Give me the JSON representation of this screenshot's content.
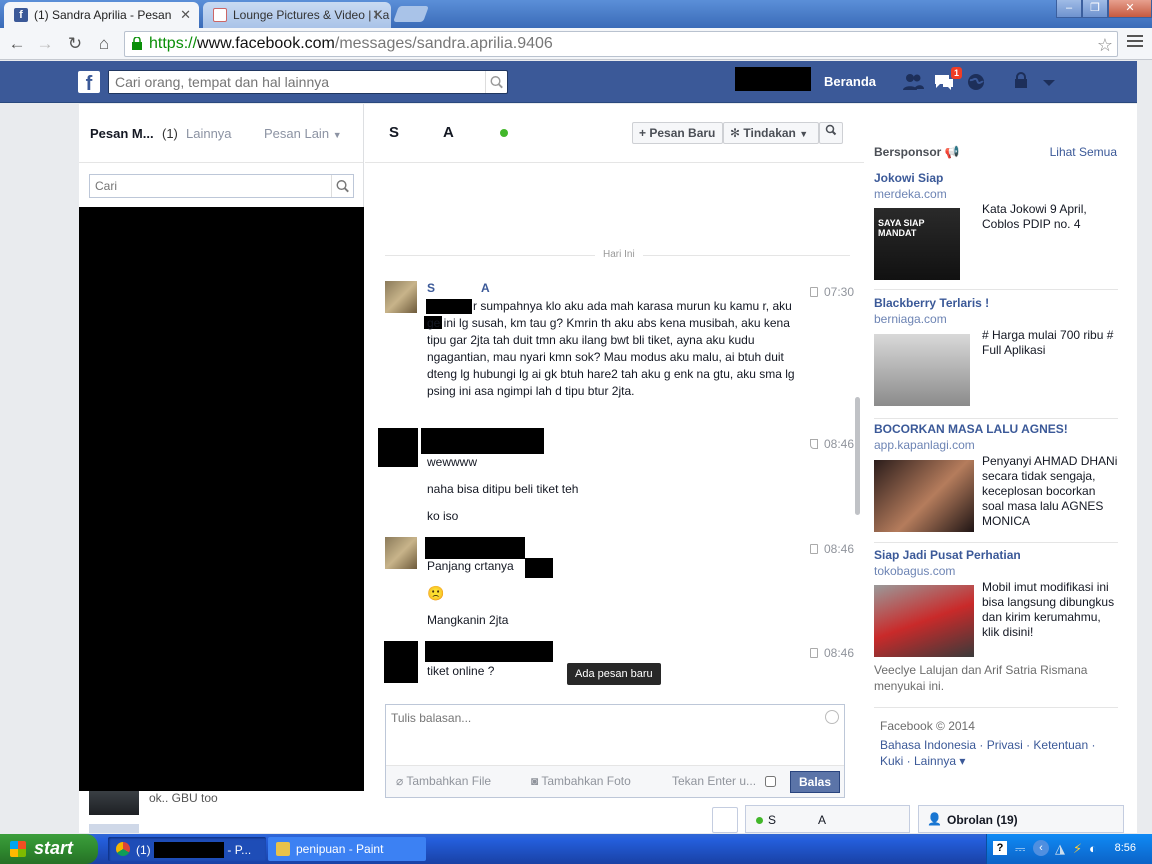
{
  "browser": {
    "tabs": [
      {
        "label": "(1) Sandra Aprilia - Pesan",
        "active": true
      },
      {
        "label": "Lounge Pictures & Video | Ka",
        "active": false
      }
    ],
    "url": {
      "scheme": "https://",
      "host": "www.facebook.com",
      "path": "/messages/sandra.aprilia.9406"
    }
  },
  "fb_header": {
    "search_placeholder": "Cari orang, tempat dan hal lainnya",
    "home_label": "Beranda",
    "notification_count": "1"
  },
  "left": {
    "title": "Pesan M...",
    "count": "(1)",
    "other_label": "Lainnya",
    "more_label": "Pesan Lain",
    "search_placeholder": "Cari",
    "last_thread_snippet": "ok.. GBU too"
  },
  "conversation": {
    "name_start": "S",
    "name_mid": "A",
    "new_message_button": "Pesan Baru",
    "actions_button": "Tindakan",
    "date_divider": "Hari Ini",
    "messages": [
      {
        "sender_start": "S",
        "sender_mid": "A",
        "time": "07:30",
        "text": "r sumpahnya klo aku ada mah karasa murun ku kamu r, aku ge ini lg susah, km tau g? Kmrin th aku abs kena musibah, aku kena tipu gar 2jta tah duit tmn aku ilang bwt bli tiket, ayna aku kudu ngagantian, mau nyari kmn sok? Mau modus aku malu, ai btuh duit dteng lg hubungi lg ai gk btuh hare2 tah aku g enk na gtu, aku sma lg psing ini asa ngimpi lah d tipu btur 2jta."
      },
      {
        "time": "08:46",
        "lines": [
          "wewwww",
          "naha bisa ditipu beli tiket teh",
          "ko iso"
        ]
      },
      {
        "time": "08:46",
        "lines": [
          "Panjang crtanya",
          "🙁",
          "Mangkanin 2jta"
        ]
      },
      {
        "time": "08:46",
        "lines": [
          "tiket online ?"
        ]
      }
    ],
    "new_message_tooltip": "Ada pesan baru",
    "reply_placeholder": "Tulis balasan...",
    "add_file": "Tambahkan File",
    "add_photo": "Tambahkan Foto",
    "enter_label": "Tekan Enter u...",
    "reply_button": "Balas"
  },
  "sponsored": {
    "header": "Bersponsor",
    "see_all": "Lihat Semua",
    "ads": [
      {
        "title": "Jokowi Siap",
        "domain": "merdeka.com",
        "text": "Kata Jokowi 9 April, Coblos PDIP no. 4"
      },
      {
        "title": "Blackberry Terlaris !",
        "domain": "berniaga.com",
        "text": "# Harga mulai 700 ribu # Full Aplikasi"
      },
      {
        "title": "BOCORKAN MASA LALU AGNES!",
        "domain": "app.kapanlagi.com",
        "text": "Penyanyi AHMAD DHANi secara tidak sengaja, keceplosan bocorkan soal masa lalu AGNES MONICA"
      },
      {
        "title": "Siap Jadi Pusat Perhatian",
        "domain": "tokobagus.com",
        "text": "Mobil imut modifikasi ini bisa langsung dibungkus dan kirim kerumahmu, klik disini!"
      }
    ],
    "likes_text": "Veeclye Lalujan dan Arif Satria Rismana menyukai ini.",
    "ad_image_text": "SAYA SIAP MANDAT"
  },
  "footer": {
    "copyright": "Facebook © 2014",
    "links": "Bahasa Indonesia · Privasi · Ketentuan · Kuki · Lainnya ▾"
  },
  "chatbar": {
    "chat_name_start": "S",
    "chat_name_mid": "A",
    "obrolan": "Obrolan (19)"
  },
  "taskbar": {
    "start": "start",
    "task1_prefix": "(1)",
    "task1_suffix": "- P...",
    "task2": "penipuan - Paint",
    "clock": "8:56"
  },
  "colors": {
    "facebook_blue": "#3b5998",
    "online_green": "#42b72a",
    "badge_red": "#f03d25"
  }
}
